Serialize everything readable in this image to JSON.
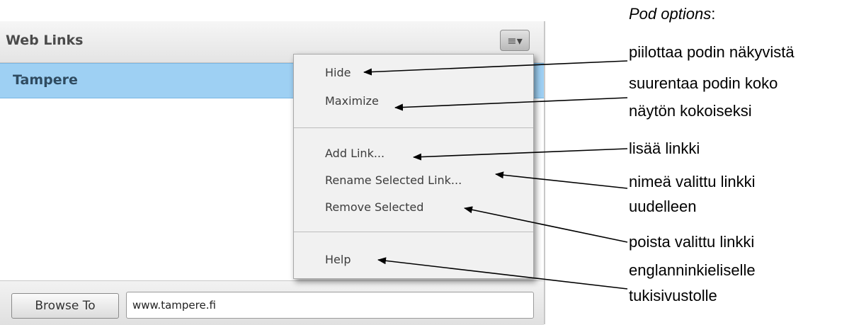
{
  "pod": {
    "title": "Web Links",
    "menu_button_icon": "≡▾",
    "list_items": [
      "Tampere"
    ],
    "browse_button": "Browse To",
    "url_value": "www.tampere.fi"
  },
  "menu": {
    "hide": "Hide",
    "maximize": "Maximize",
    "add_link": "Add Link...",
    "rename_link": "Rename Selected Link...",
    "remove_selected": "Remove Selected",
    "help": "Help"
  },
  "annotations": {
    "title": "Pod options",
    "title_suffix": ":",
    "hide": "piilottaa podin näkyvistä",
    "maximize_line1": "suurentaa podin koko",
    "maximize_line2": "näytön kokoiseksi",
    "add_link": "lisää linkki",
    "rename_line1": "nimeä valittu linkki",
    "rename_line2": "uudelleen",
    "remove": "poista valittu linkki",
    "help_line1": "englanninkieliselle",
    "help_line2": "tukisivustolle"
  },
  "colors": {
    "selection": "#9ed0f3",
    "menu_bg": "#f1f1f1",
    "header_bg": "#e4e4e4"
  }
}
